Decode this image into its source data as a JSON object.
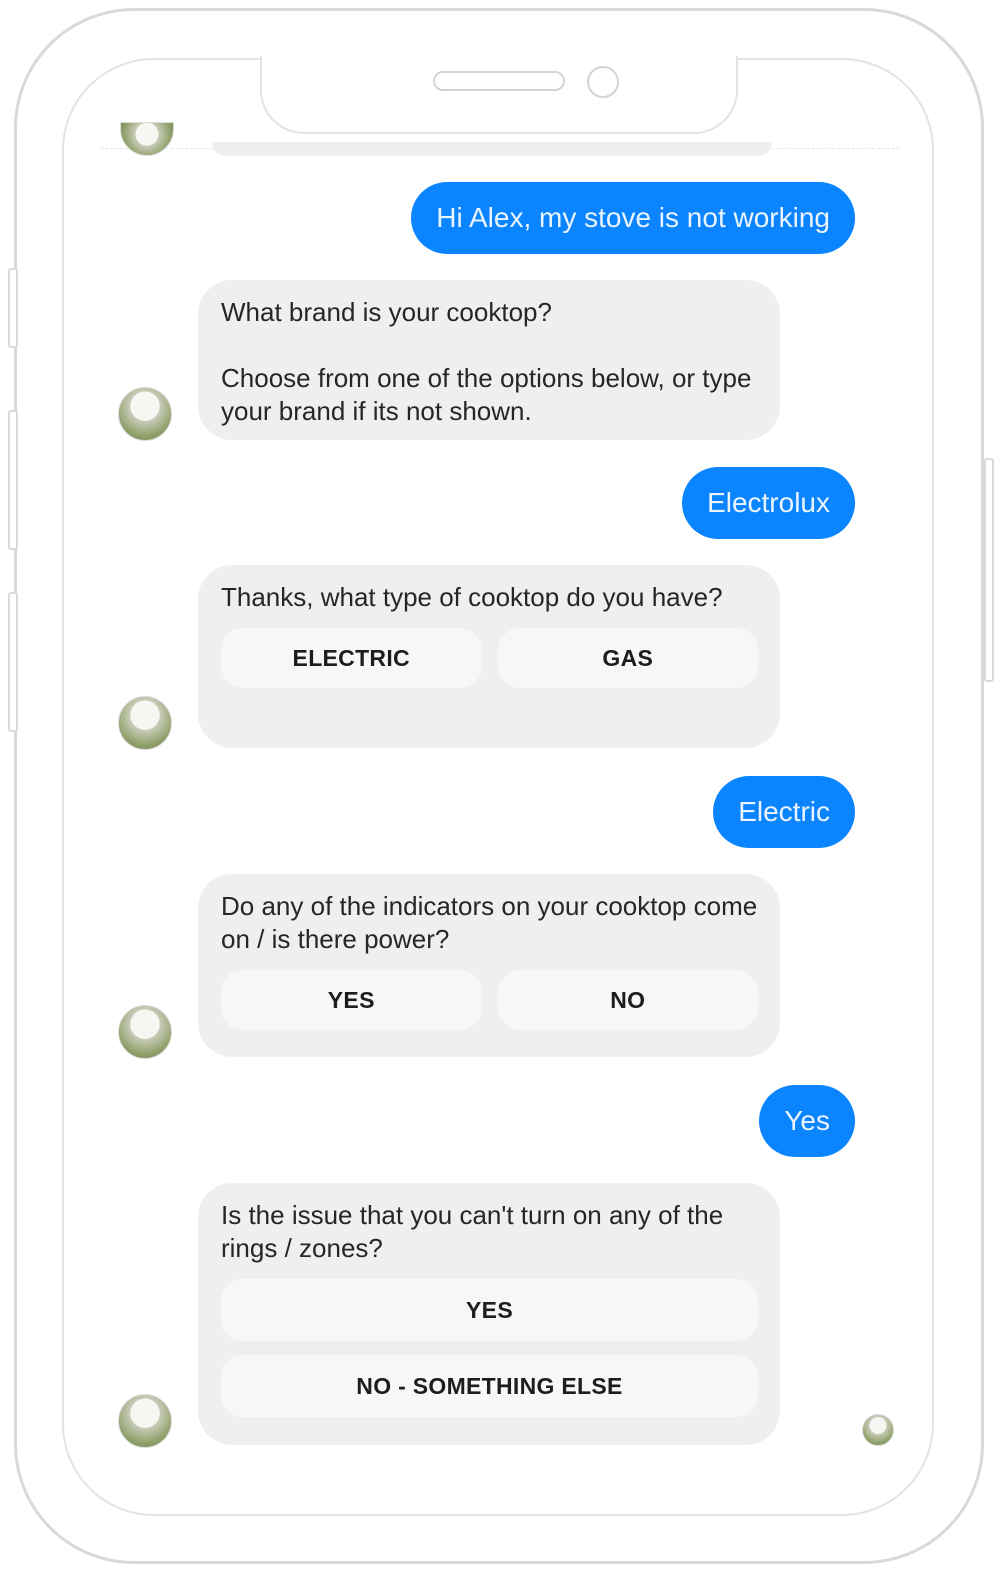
{
  "conversation": {
    "m1": {
      "text": "Hi Alex, my stove is not working"
    },
    "b1": {
      "text": "What brand is your cooktop?\n\nChoose from one of the options below, or type your brand if its not shown."
    },
    "m2": {
      "text": "Electrolux"
    },
    "b2": {
      "text": "Thanks, what type of cooktop do you have?",
      "options": [
        "ELECTRIC",
        "GAS"
      ]
    },
    "m3": {
      "text": "Electric"
    },
    "b3": {
      "text": "Do any of the indicators on your cooktop come on / is there power?",
      "options": [
        "YES",
        "NO"
      ]
    },
    "m4": {
      "text": "Yes"
    },
    "b4": {
      "text": "Is the issue that you can't turn on any of the rings / zones?",
      "options": [
        "YES",
        "NO - SOMETHING ELSE"
      ]
    }
  },
  "colors": {
    "user_bubble": "#0a84ff",
    "bot_bubble": "#efefef",
    "quick_reply": "#f7f7f7"
  }
}
